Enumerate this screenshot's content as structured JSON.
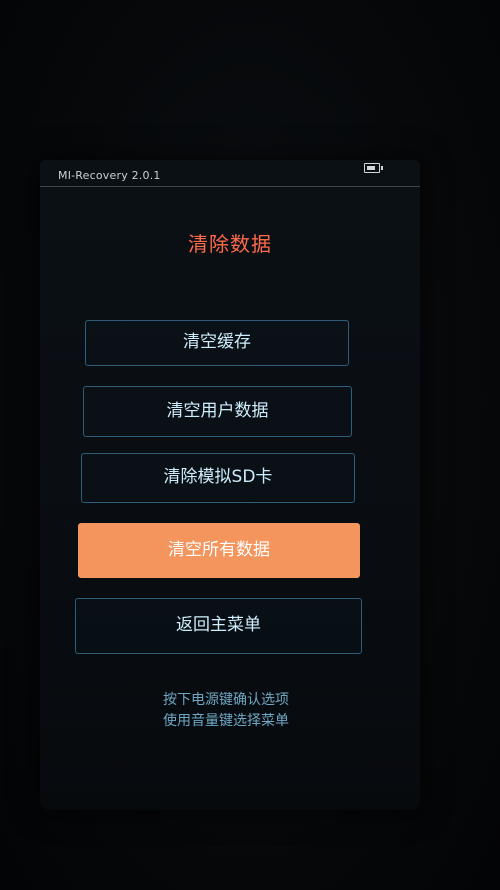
{
  "status_bar": {
    "title": "MI-Recovery 2.0.1",
    "battery_icon": "battery-icon"
  },
  "page": {
    "title": "清除数据"
  },
  "menu": {
    "items": [
      {
        "label": "清空缓存",
        "selected": false
      },
      {
        "label": "清空用户数据",
        "selected": false
      },
      {
        "label": "清除模拟SD卡",
        "selected": false
      },
      {
        "label": "清空所有数据",
        "selected": true
      },
      {
        "label": "返回主菜单",
        "selected": false
      }
    ]
  },
  "hints": {
    "line1": "按下电源键确认选项",
    "line2": "使用音量键选择菜单"
  },
  "colors": {
    "title": "#ff6a4a",
    "selected_bg": "#f4955e",
    "button_border": "#2d5d78",
    "button_text": "#cfeefd",
    "hint_text": "#6fa8c4"
  }
}
